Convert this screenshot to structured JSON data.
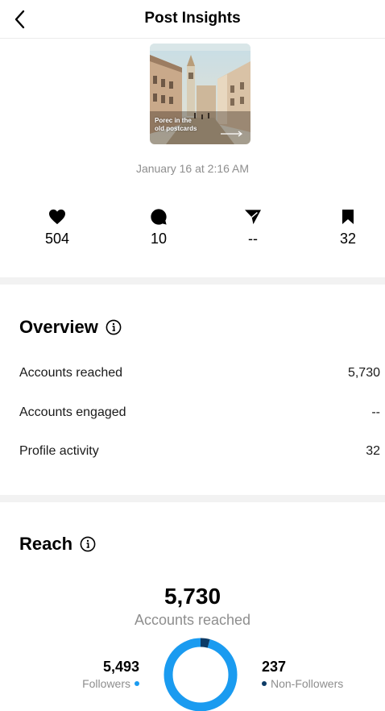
{
  "header": {
    "title": "Post Insights"
  },
  "post": {
    "thumbnail_caption_line1": "Porec in the",
    "thumbnail_caption_line2": "old postcards",
    "date": "January 16 at 2:16 AM"
  },
  "stats": {
    "likes": "504",
    "comments": "10",
    "shares": "--",
    "saves": "32"
  },
  "overview": {
    "title": "Overview",
    "rows": [
      {
        "label": "Accounts reached",
        "value": "5,730"
      },
      {
        "label": "Accounts engaged",
        "value": "--"
      },
      {
        "label": "Profile activity",
        "value": "32"
      }
    ]
  },
  "reach": {
    "title": "Reach",
    "total": "5,730",
    "total_label": "Accounts reached",
    "followers": {
      "value": "5,493",
      "label": "Followers",
      "count": 5493
    },
    "non_followers": {
      "value": "237",
      "label": "Non-Followers",
      "count": 237
    }
  },
  "colors": {
    "followers": "#1a9bf0",
    "non_followers": "#0d3b66"
  }
}
